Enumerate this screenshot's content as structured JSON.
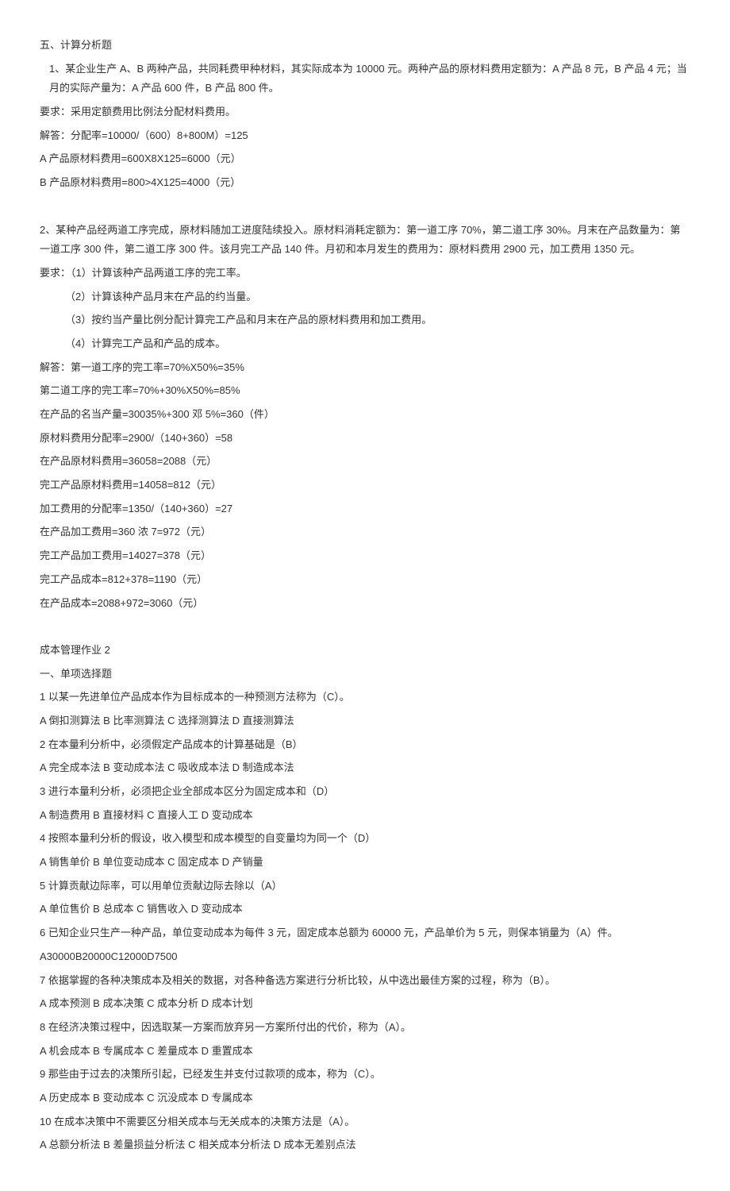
{
  "section5_title": "五、计算分析题",
  "q1_l1": "1、某企业生产 A、B 两种产品，共同耗费甲种材料，其实际成本为 10000 元。两种产品的原材料费用定额为：A 产品 8 元，B 产品 4 元；当月的实际产量为：A 产品 600 件，B 产品 800 件。",
  "q1_l2": "要求：采用定额费用比例法分配材料费用。",
  "q1_l3": "解答：分配率=10000/（600）8+800M）=125",
  "q1_l4": "A 产品原材料费用=600X8X125=6000（元）",
  "q1_l5": "B 产品原材料费用=800>4X125=4000（元）",
  "q2_l1": "2、某种产品经两道工序完成，原材料随加工进度陆续投入。原材料消耗定额为：第一道工序 70%，第二道工序 30%。月末在产品数量为：第一道工序 300 件，第二道工序 300 件。该月完工产品 140 件。月初和本月发生的费用为：原材料费用 2900 元，加工费用 1350 元。",
  "q2_l2": "要求：（1）计算该种产品两道工序的完工率。",
  "q2_l3": "（2）计算该种产品月末在产品的约当量。",
  "q2_l4": "（3）按约当产量比例分配计算完工产品和月末在产品的原材料费用和加工费用。",
  "q2_l5": "（4）计算完工产品和产品的成本。",
  "q2_l6": "解答：第一道工序的完工率=70%X50%=35%",
  "q2_l7": "第二道工序的完工率=70%+30%X50%=85%",
  "q2_l8": "在产品的名当产量=30035%+300 邓 5%=360（件）",
  "q2_l9": "原材料费用分配率=2900/（140+360）=58",
  "q2_l10": "在产品原材料费用=36058=2088（元）",
  "q2_l11": "完工产品原材料费用=14058=812（元）",
  "q2_l12": "加工费用的分配率=1350/（140+360）=27",
  "q2_l13": "在产品加工费用=360 浓 7=972（元）",
  "q2_l14": "完工产品加工费用=14027=378（元）",
  "q2_l15": "完工产品成本=812+378=1190（元）",
  "q2_l16": "在产品成本=2088+972=3060（元）",
  "hw2_title": "成本管理作业 2",
  "mc_title": "一、单项选择题",
  "mc1_q": "1  以某一先进单位产品成本作为目标成本的一种预测方法称为（C）。",
  "mc1_a": "A 倒扣测算法 B 比率测算法 C 选择测算法 D 直接测算法",
  "mc2_q": "2  在本量利分析中，必须假定产品成本的计算基础是（B）",
  "mc2_a": "A 完全成本法 B 变动成本法 C 吸收成本法 D 制造成本法",
  "mc3_q": "3  进行本量利分析，必须把企业全部成本区分为固定成本和（D）",
  "mc3_a": "A 制造费用 B 直接材料 C 直接人工 D 变动成本",
  "mc4_q": "4  按照本量利分析的假设，收入模型和成本模型的自变量均为同一个（D）",
  "mc4_a": "A 销售单价 B 单位变动成本 C 固定成本 D 产销量",
  "mc5_q": "5  计算贡献边际率，可以用单位贡献边际去除以（A）",
  "mc5_a": "A 单位售价 B 总成本 C 销售收入 D 变动成本",
  "mc6_q": "6  已知企业只生产一种产品，单位变动成本为每件 3 元，固定成本总额为 60000 元，产品单价为 5 元，则保本销量为（A）件。",
  "mc6_a": "A30000B20000C12000D7500",
  "mc7_q": "7  依据掌握的各种决策成本及相关的数据，对各种备选方案进行分析比较，从中选出最佳方案的过程，称为（B）。",
  "mc7_a": "A 成本预测 B 成本决策 C 成本分析 D 成本计划",
  "mc8_q": "8  在经济决策过程中，因选取某一方案而放弃另一方案所付出的代价，称为（A）。",
  "mc8_a": "A 机会成本 B 专属成本 C 差量成本 D 重置成本",
  "mc9_q": "9  那些由于过去的决策所引起，已经发生并支付过款项的成本，称为（C）。",
  "mc9_a": "A 历史成本 B 变动成本 C 沉没成本 D 专属成本",
  "mc10_q": "10  在成本决策中不需要区分相关成本与无关成本的决策方法是（A）。",
  "mc10_a": "A 总额分析法 B 差量损益分析法 C 相关成本分析法 D 成本无差别点法"
}
